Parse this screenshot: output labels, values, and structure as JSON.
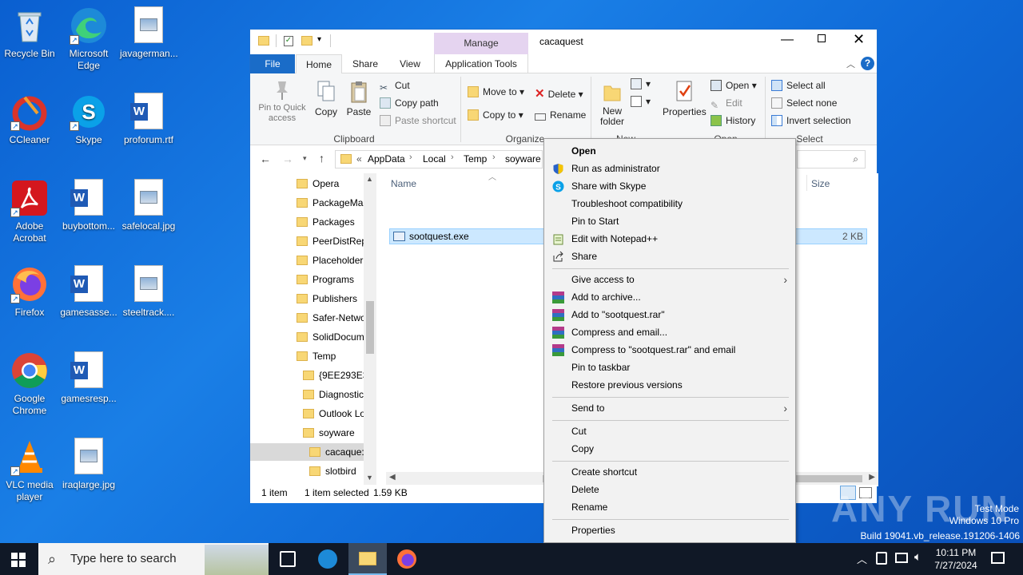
{
  "desktop": {
    "icons": [
      {
        "label": "Recycle Bin",
        "icon": "recycle-bin-icon"
      },
      {
        "label": "Microsoft Edge",
        "icon": "edge-icon"
      },
      {
        "label": "javagerman...",
        "icon": "image-file-icon"
      },
      {
        "label": "CCleaner",
        "icon": "ccleaner-icon"
      },
      {
        "label": "Skype",
        "icon": "skype-icon"
      },
      {
        "label": "proforum.rtf",
        "icon": "word-doc-icon"
      },
      {
        "label": "Adobe Acrobat",
        "icon": "acrobat-icon"
      },
      {
        "label": "buybottom...",
        "icon": "word-doc-icon"
      },
      {
        "label": "safelocal.jpg",
        "icon": "image-file-icon"
      },
      {
        "label": "Firefox",
        "icon": "firefox-icon"
      },
      {
        "label": "gamesasse...",
        "icon": "word-doc-icon"
      },
      {
        "label": "steeltrack....",
        "icon": "image-file-icon"
      },
      {
        "label": "Google Chrome",
        "icon": "chrome-icon"
      },
      {
        "label": "gamesresp...",
        "icon": "word-doc-icon"
      },
      {
        "label": "VLC media player",
        "icon": "vlc-icon"
      },
      {
        "label": "iraqlarge.jpg",
        "icon": "image-file-icon"
      }
    ]
  },
  "explorer": {
    "title": "cacaquest",
    "contextual_tab": "Manage",
    "tabs": [
      "File",
      "Home",
      "Share",
      "View",
      "Application Tools"
    ],
    "ribbon": {
      "pin": "Pin to Quick access",
      "copy": "Copy",
      "paste": "Paste",
      "cut": "Cut",
      "copy_path": "Copy path",
      "paste_shortcut": "Paste shortcut",
      "clipboard": "Clipboard",
      "move_to": "Move to",
      "copy_to": "Copy to",
      "delete": "Delete",
      "rename": "Rename",
      "organize": "Organize",
      "new_folder": "New folder",
      "new": "New",
      "properties": "Properties",
      "open": "Open",
      "edit": "Edit",
      "history": "History",
      "open_group": "Open",
      "select_all": "Select all",
      "select_none": "Select none",
      "invert": "Invert selection",
      "select": "Select"
    },
    "breadcrumb": [
      "«",
      "AppData",
      "Local",
      "Temp",
      "soyware"
    ],
    "nav": [
      "Opera",
      "PackageMa",
      "Packages",
      "PeerDistRep",
      "Placeholder",
      "Programs",
      "Publishers",
      "Safer-Netwo",
      "SolidDocum",
      "Temp",
      "{9EE293E3-",
      "Diagnostic",
      "Outlook Lo",
      "soyware",
      "cacaque:",
      "slotbird"
    ],
    "columns": {
      "name": "Name",
      "size": "Size"
    },
    "files": [
      {
        "name": "sootquest.exe",
        "size": "2 KB"
      }
    ],
    "status": {
      "count": "1 item",
      "selected": "1 item selected",
      "size": "1.59 KB"
    }
  },
  "context_menu": {
    "items": [
      {
        "label": "Open",
        "icon": ""
      },
      {
        "label": "Run as administrator",
        "icon": "shield-icon"
      },
      {
        "label": "Share with Skype",
        "icon": "skype-icon"
      },
      {
        "label": "Troubleshoot compatibility",
        "icon": ""
      },
      {
        "label": "Pin to Start",
        "icon": ""
      },
      {
        "label": "Edit with Notepad++",
        "icon": "notepad-icon"
      },
      {
        "label": "Share",
        "icon": "share-icon"
      },
      {
        "label": "Give access to",
        "icon": ""
      },
      {
        "label": "Add to archive...",
        "icon": "winrar-icon"
      },
      {
        "label": "Add to \"sootquest.rar\"",
        "icon": "winrar-icon"
      },
      {
        "label": "Compress and email...",
        "icon": "winrar-icon"
      },
      {
        "label": "Compress to \"sootquest.rar\" and email",
        "icon": "winrar-icon"
      },
      {
        "label": "Pin to taskbar",
        "icon": ""
      },
      {
        "label": "Restore previous versions",
        "icon": ""
      },
      {
        "label": "Send to",
        "icon": ""
      },
      {
        "label": "Cut",
        "icon": ""
      },
      {
        "label": "Copy",
        "icon": ""
      },
      {
        "label": "Create shortcut",
        "icon": ""
      },
      {
        "label": "Delete",
        "icon": ""
      },
      {
        "label": "Rename",
        "icon": ""
      },
      {
        "label": "Properties",
        "icon": ""
      }
    ]
  },
  "watermark": {
    "test_mode": "Test Mode",
    "edition": "Windows 10 Pro",
    "build": "Build 19041.vb_release.191206-1406",
    "brand": "ANY RUN"
  },
  "taskbar": {
    "search_placeholder": "Type here to search",
    "time": "10:11 PM",
    "date": "7/27/2024"
  }
}
